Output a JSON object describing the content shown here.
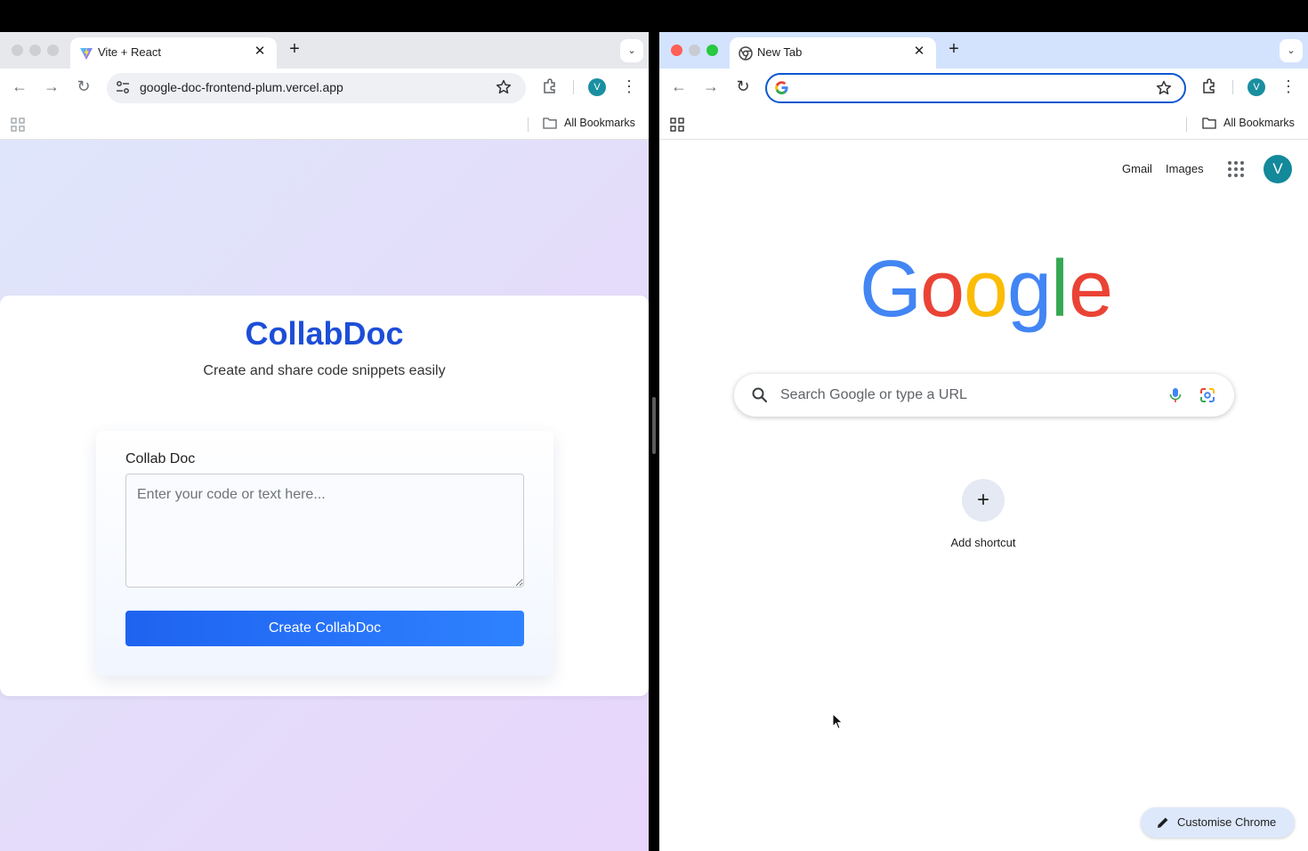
{
  "left_window": {
    "tab_title": "Vite + React",
    "address": "google-doc-frontend-plum.vercel.app",
    "profile_initial": "V",
    "bookmarks_label": "All Bookmarks",
    "page": {
      "brand": "CollabDoc",
      "tagline": "Create and share code snippets easily",
      "form_label": "Collab Doc",
      "textarea_placeholder": "Enter your code or text here...",
      "textarea_value": "",
      "submit_label": "Create CollabDoc"
    }
  },
  "right_window": {
    "tab_title": "New Tab",
    "address": "",
    "profile_initial": "V",
    "bookmarks_label": "All Bookmarks",
    "page": {
      "gmail_link": "Gmail",
      "images_link": "Images",
      "avatar_initial": "V",
      "search_placeholder": "Search Google or type a URL",
      "add_shortcut_label": "Add shortcut",
      "customise_label": "Customise Chrome"
    }
  },
  "colors": {
    "brand_blue": "#1d4ed8",
    "button_blue": "#1e63f0",
    "chrome_focus": "#0b57d0",
    "google_blue": "#4285F4",
    "google_red": "#EA4335",
    "google_yellow": "#FBBC05",
    "google_green": "#34A853"
  }
}
